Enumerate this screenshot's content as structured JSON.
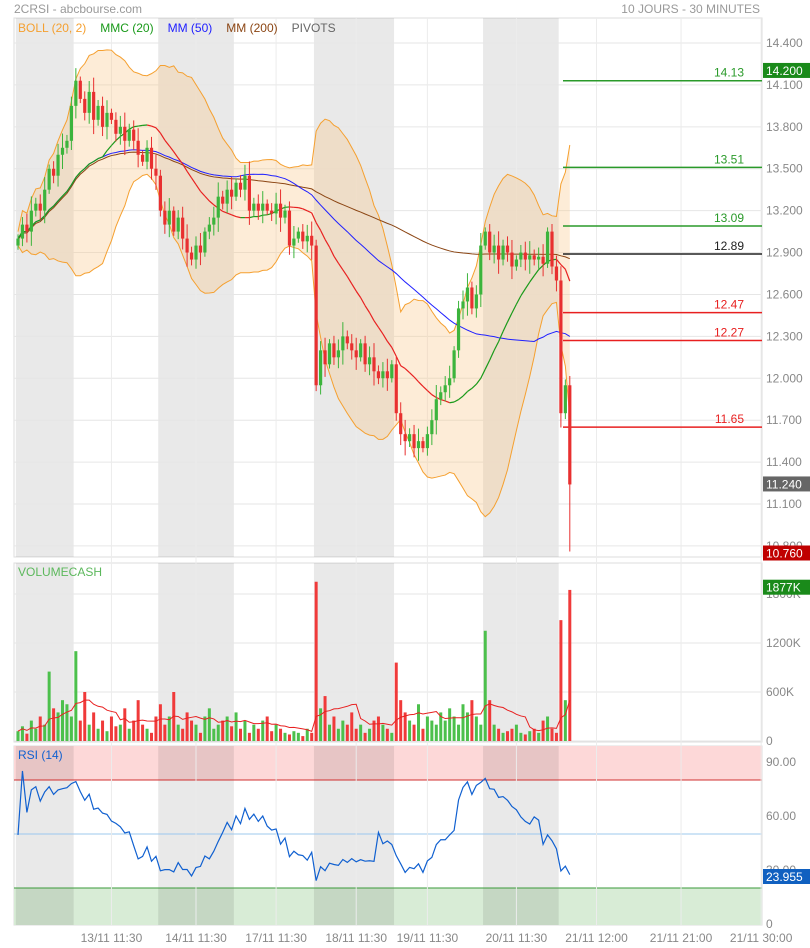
{
  "header": {
    "title": "2CRSI - abcbourse.com",
    "period": "10 JOURS - 30 MINUTES"
  },
  "legend": [
    {
      "label": "BOLL (20, 2)",
      "color": "#f5a030"
    },
    {
      "label": "MMC (20)",
      "color": "#1a9a1a"
    },
    {
      "label": "MM (50)",
      "color": "#2020ff"
    },
    {
      "label": "MM (200)",
      "color": "#8b4513"
    },
    {
      "label": "PIVOTS",
      "color": "#666666"
    }
  ],
  "chart_data": {
    "type": "candlestick",
    "title": "2CRSI",
    "price_axis": {
      "ticks": [
        "14.400",
        "14.100",
        "13.800",
        "13.500",
        "13.200",
        "12.900",
        "12.600",
        "12.300",
        "12.000",
        "11.700",
        "11.400",
        "11.100",
        "10.800"
      ],
      "range": [
        10.8,
        14.4
      ]
    },
    "badges": [
      {
        "label": "14.200",
        "value": 14.2,
        "color": "#1a8a1a"
      },
      {
        "label": "11.240",
        "value": 11.24,
        "color": "#666666"
      },
      {
        "label": "10.760",
        "value": 10.76,
        "color": "#c00000"
      }
    ],
    "pivots": [
      {
        "label": "14.13",
        "value": 14.13,
        "color": "#2a9a2a"
      },
      {
        "label": "13.51",
        "value": 13.51,
        "color": "#2a9a2a"
      },
      {
        "label": "13.09",
        "value": 13.09,
        "color": "#2a9a2a"
      },
      {
        "label": "12.89",
        "value": 12.89,
        "color": "#222222"
      },
      {
        "label": "12.47",
        "value": 12.47,
        "color": "#e82020"
      },
      {
        "label": "12.27",
        "value": 12.27,
        "color": "#e82020"
      },
      {
        "label": "11.65",
        "value": 11.65,
        "color": "#e82020"
      }
    ],
    "closes": [
      13.0,
      13.1,
      13.05,
      13.2,
      13.25,
      13.2,
      13.35,
      13.5,
      13.45,
      13.6,
      13.65,
      13.7,
      13.95,
      14.13,
      14.0,
      13.9,
      14.05,
      13.85,
      13.95,
      13.8,
      13.9,
      13.85,
      13.75,
      13.8,
      13.7,
      13.78,
      13.7,
      13.6,
      13.55,
      13.65,
      13.5,
      13.45,
      13.2,
      13.1,
      13.2,
      13.05,
      13.15,
      13.0,
      12.9,
      12.85,
      12.95,
      12.9,
      13.05,
      13.1,
      13.15,
      13.3,
      13.25,
      13.35,
      13.3,
      13.4,
      13.35,
      13.45,
      13.2,
      13.25,
      13.2,
      13.25,
      13.2,
      13.18,
      13.25,
      13.15,
      13.2,
      12.95,
      13.0,
      13.05,
      12.98,
      13.02,
      12.95,
      11.95,
      12.2,
      12.1,
      12.25,
      12.15,
      12.2,
      12.3,
      12.25,
      12.2,
      12.15,
      12.25,
      12.1,
      12.15,
      12.05,
      12.0,
      12.05,
      12.0,
      12.1,
      11.75,
      11.6,
      11.55,
      11.6,
      11.5,
      11.55,
      11.5,
      11.6,
      11.7,
      11.85,
      11.9,
      11.95,
      12.0,
      12.2,
      12.5,
      12.55,
      12.65,
      12.5,
      12.6,
      12.95,
      13.05,
      12.9,
      12.95,
      12.85,
      12.95,
      12.9,
      12.8,
      12.85,
      12.9,
      12.85,
      12.88,
      12.85,
      12.87,
      12.82,
      13.05,
      12.8,
      12.7,
      11.75,
      11.95,
      11.24
    ],
    "first_open": 12.95,
    "last_low": 10.76,
    "volume_axis": {
      "ticks": [
        "1800K",
        "1200K",
        "600K",
        "0"
      ],
      "label": "VOLUMECASH",
      "badge": "1877K",
      "badge_color": "#1a8a1a"
    },
    "volumes_k": [
      120,
      180,
      90,
      250,
      150,
      300,
      200,
      850,
      400,
      350,
      500,
      450,
      300,
      1100,
      250,
      600,
      200,
      350,
      150,
      250,
      120,
      300,
      180,
      200,
      400,
      150,
      250,
      500,
      200,
      150,
      100,
      300,
      450,
      200,
      300,
      600,
      200,
      150,
      350,
      250,
      200,
      100,
      300,
      400,
      150,
      200,
      250,
      300,
      180,
      350,
      150,
      250,
      100,
      200,
      150,
      250,
      300,
      120,
      200,
      150,
      100,
      80,
      120,
      100,
      60,
      150,
      100,
      1950,
      400,
      550,
      200,
      300,
      150,
      250,
      200,
      350,
      150,
      200,
      100,
      150,
      250,
      300,
      200,
      150,
      100,
      960,
      500,
      350,
      250,
      200,
      450,
      150,
      300,
      250,
      200,
      350,
      250,
      400,
      300,
      200,
      450,
      350,
      500,
      300,
      200,
      1350,
      500,
      200,
      150,
      100,
      120,
      150,
      200,
      100,
      80,
      120,
      150,
      100,
      250,
      300,
      150,
      100,
      1480,
      500,
      1850
    ],
    "rsi": {
      "label": "RSI (14)",
      "ticks": [
        "90.00",
        "60.00",
        "30.00",
        "0"
      ],
      "badge": "23.955",
      "badge_color": "#1060c0",
      "overbought": 80,
      "oversold": 20
    },
    "day_start_indices": [
      0,
      13,
      32,
      49,
      67,
      85,
      105,
      122
    ],
    "x_ticks": [
      {
        "label": "13/11 11:30",
        "index": 21
      },
      {
        "label": "14/11 11:30",
        "index": 40
      },
      {
        "label": "17/11 11:30",
        "index": 58
      },
      {
        "label": "18/11 11:30",
        "index": 76
      },
      {
        "label": "19/11 11:30",
        "index": 92
      },
      {
        "label": "20/11 11:30",
        "index": 112
      },
      {
        "label": "21/11 12:00",
        "index": 130
      },
      {
        "label": "21/11 21:00",
        "index": 149
      },
      {
        "label": "21/11 30:00",
        "index": 167
      }
    ]
  }
}
